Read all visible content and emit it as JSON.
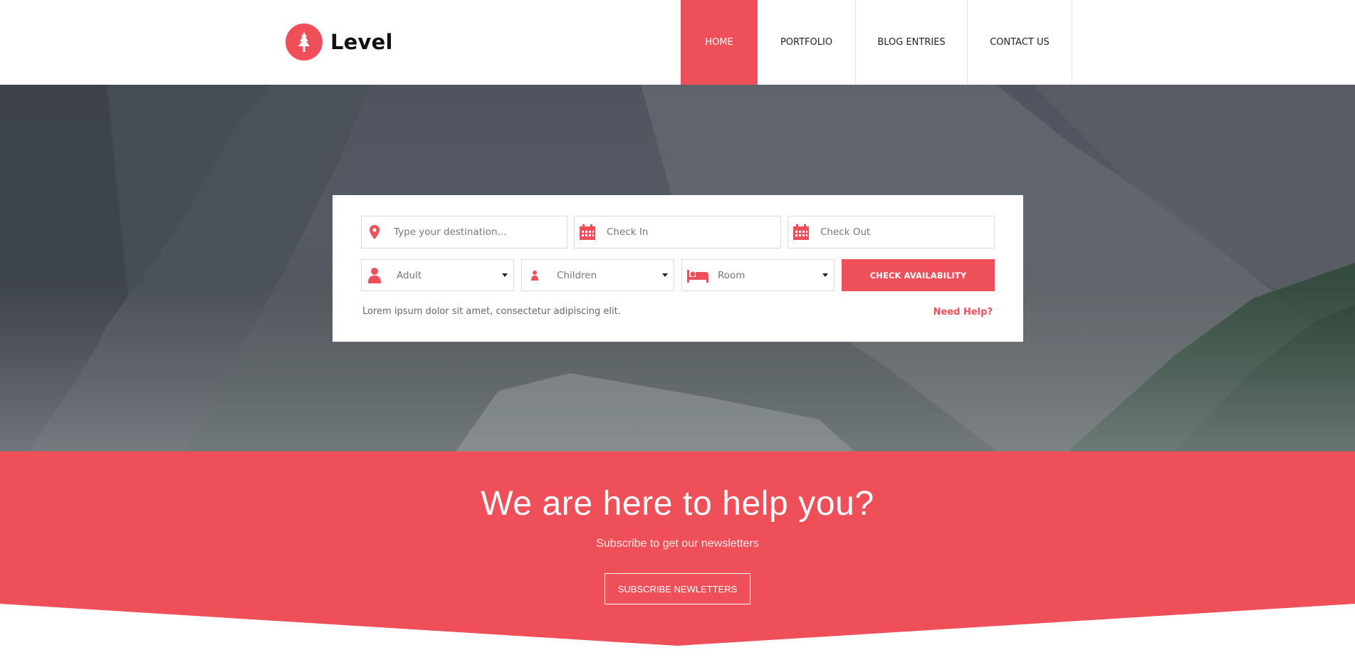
{
  "brand": {
    "name": "Level",
    "accent": "#ee4f58",
    "logo_icon": "tree-icon"
  },
  "nav": {
    "items": [
      {
        "label": "HOME",
        "active": true
      },
      {
        "label": "PORTFOLIO",
        "active": false
      },
      {
        "label": "BLOG ENTRIES",
        "active": false
      },
      {
        "label": "CONTACT US",
        "active": false
      }
    ]
  },
  "booking": {
    "destination": {
      "placeholder": "Type your destination...",
      "icon": "map-pin-icon"
    },
    "check_in": {
      "placeholder": "Check In",
      "icon": "calendar-icon"
    },
    "check_out": {
      "placeholder": "Check Out",
      "icon": "calendar-icon"
    },
    "adult": {
      "selected": "Adult",
      "icon": "user-icon"
    },
    "children": {
      "selected": "Children",
      "icon": "child-icon"
    },
    "room": {
      "selected": "Room",
      "icon": "bed-icon"
    },
    "submit_label": "CHECK AVAILABILITY",
    "note": "Lorem ipsum dolor sit amet, consectetur adipiscing elit.",
    "help_label": "Need Help?"
  },
  "cta": {
    "title": "We are here to help you?",
    "subtitle": "Subscribe to get our newsletters",
    "button_label": "SUBSCRIBE NEWLETTERS"
  }
}
